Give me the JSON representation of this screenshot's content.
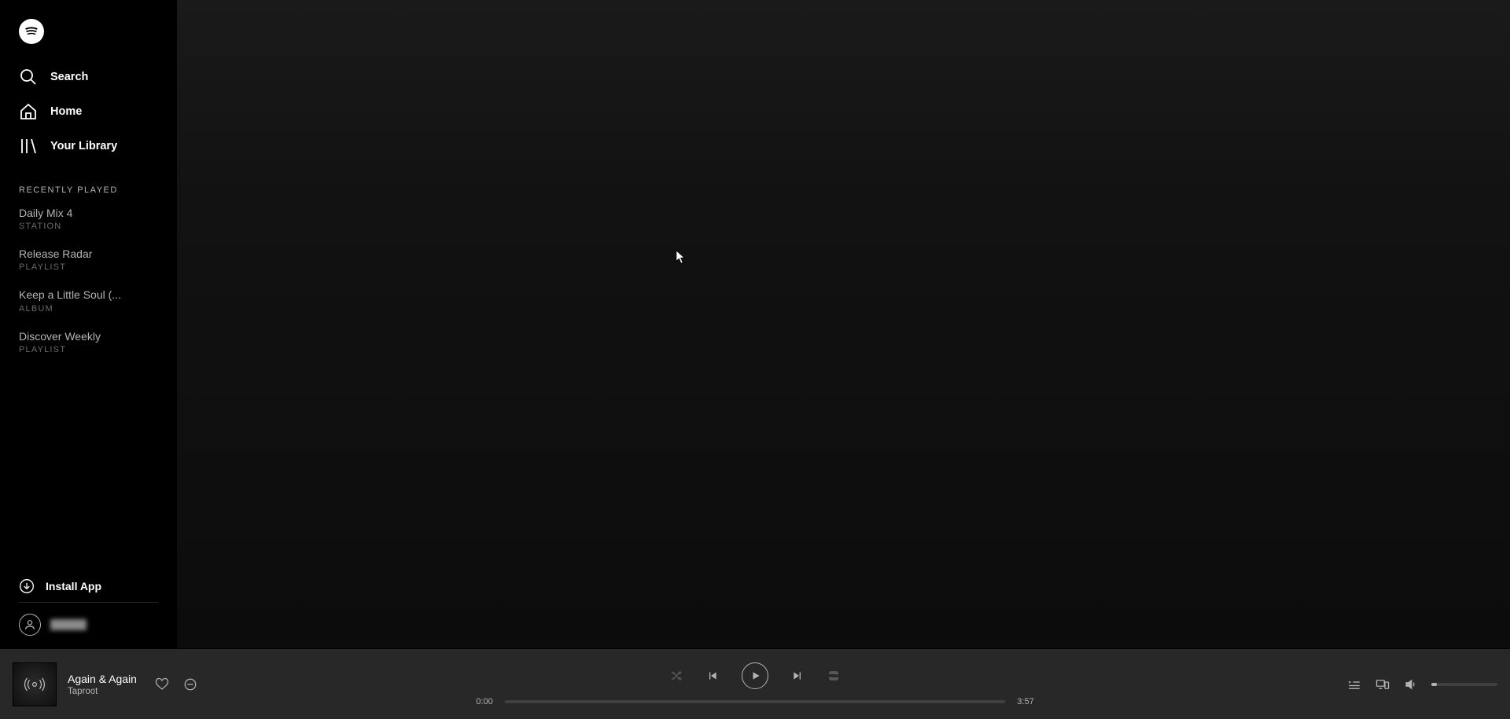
{
  "sidebar": {
    "nav": {
      "search": "Search",
      "home": "Home",
      "library": "Your Library"
    },
    "recently_played_header": "RECENTLY PLAYED",
    "recent": [
      {
        "title": "Daily Mix 4",
        "type": "STATION"
      },
      {
        "title": "Release Radar",
        "type": "PLAYLIST"
      },
      {
        "title": "Keep a Little Soul (...",
        "type": "ALBUM"
      },
      {
        "title": "Discover Weekly",
        "type": "PLAYLIST"
      }
    ],
    "install_label": "Install App"
  },
  "player": {
    "track_title": "Again & Again",
    "track_artist": "Taproot",
    "elapsed": "0:00",
    "duration": "3:57",
    "volume_percent": 8
  }
}
